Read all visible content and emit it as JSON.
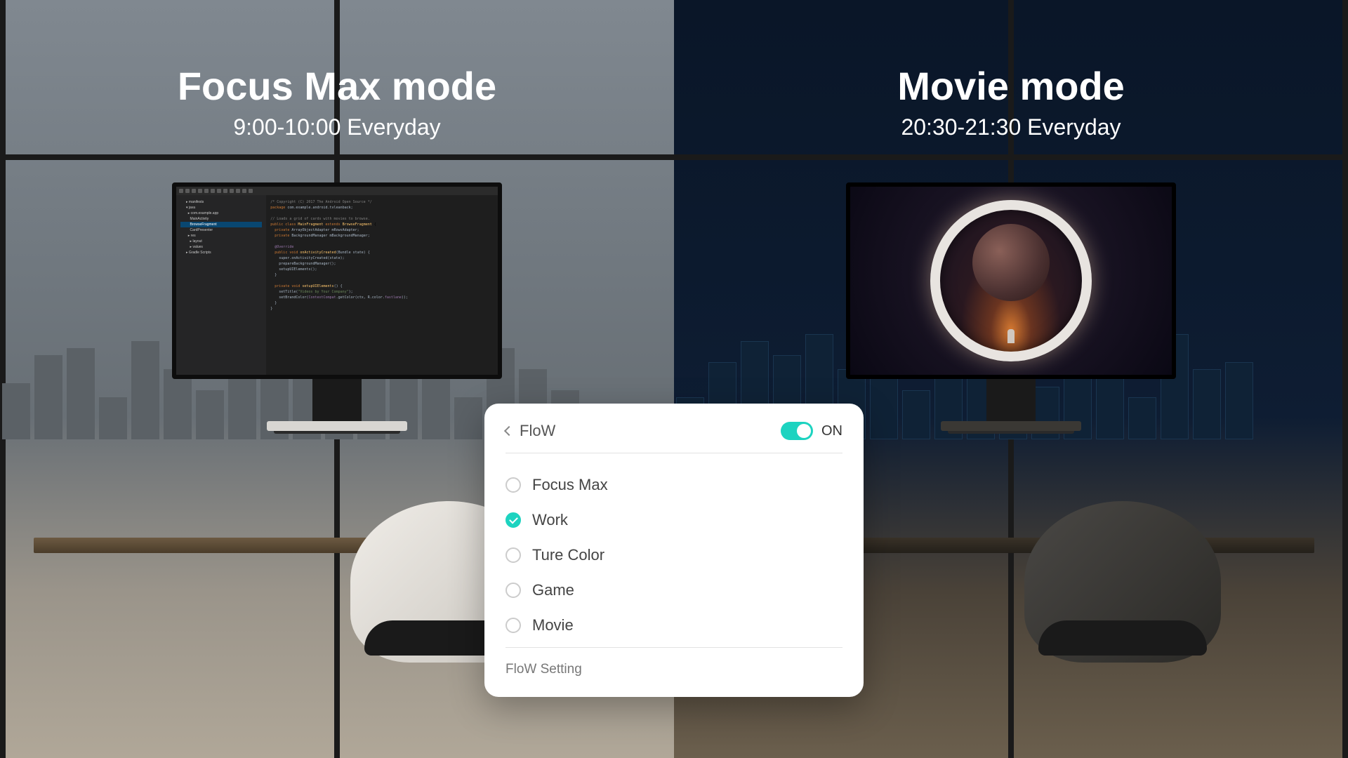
{
  "left": {
    "title": "Focus Max mode",
    "schedule": "9:00-10:00 Everyday"
  },
  "right": {
    "title": "Movie mode",
    "schedule": "20:30-21:30 Everyday"
  },
  "panel": {
    "title": "FloW",
    "toggle_label": "ON",
    "toggle_on": true,
    "options": [
      {
        "label": "Focus Max",
        "selected": false
      },
      {
        "label": "Work",
        "selected": true
      },
      {
        "label": "Ture Color",
        "selected": false
      },
      {
        "label": "Game",
        "selected": false
      },
      {
        "label": "Movie",
        "selected": false
      }
    ],
    "footer": "FloW Setting"
  }
}
